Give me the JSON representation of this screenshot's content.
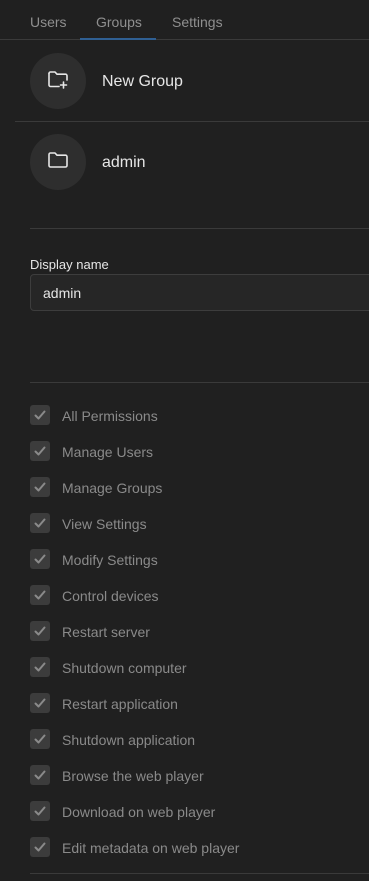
{
  "tabs": [
    {
      "label": "Users"
    },
    {
      "label": "Groups",
      "active": true
    },
    {
      "label": "Settings"
    }
  ],
  "groups": {
    "new_group_label": "New Group",
    "items": [
      {
        "label": "admin",
        "icon": "folder-icon"
      }
    ]
  },
  "form": {
    "display_name_label": "Display name",
    "display_name_value": "admin"
  },
  "permissions": [
    {
      "label": "All Permissions",
      "checked": true
    },
    {
      "label": "Manage Users",
      "checked": true
    },
    {
      "label": "Manage Groups",
      "checked": true
    },
    {
      "label": "View Settings",
      "checked": true
    },
    {
      "label": "Modify Settings",
      "checked": true
    },
    {
      "label": "Control devices",
      "checked": true
    },
    {
      "label": "Restart server",
      "checked": true
    },
    {
      "label": "Shutdown computer",
      "checked": true
    },
    {
      "label": "Restart application",
      "checked": true
    },
    {
      "label": "Shutdown application",
      "checked": true
    },
    {
      "label": "Browse the web player",
      "checked": true
    },
    {
      "label": "Download on web player",
      "checked": true
    },
    {
      "label": "Edit metadata on web player",
      "checked": true
    }
  ],
  "colors": {
    "background": "#202020",
    "accent": "#2f5f93",
    "checkbox": "#3c3c3c",
    "disabled_text": "#8a8a8a"
  }
}
